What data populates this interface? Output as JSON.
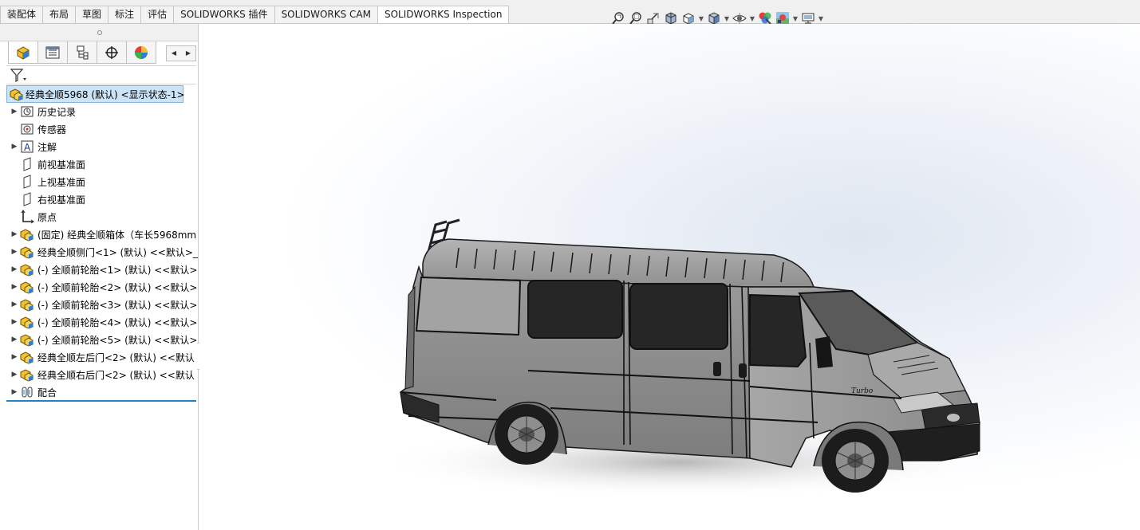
{
  "command_tabs": [
    "装配体",
    "布局",
    "草图",
    "标注",
    "评估",
    "SOLIDWORKS 插件",
    "SOLIDWORKS CAM",
    "SOLIDWORKS Inspection"
  ],
  "active_tab_index": 7,
  "heads_up_toolbar": [
    "zoom-to-fit-icon",
    "zoom-area-icon",
    "previous-view-icon",
    "section-view-icon",
    "view-orientation-icon",
    "display-style-icon",
    "hide-show-items-icon",
    "edit-appearance-icon",
    "apply-scene-icon",
    "view-settings-icon"
  ],
  "panel_tabs": [
    "feature-manager-icon",
    "property-manager-icon",
    "configuration-manager-icon",
    "dimxpert-manager-icon",
    "display-manager-icon"
  ],
  "tree": {
    "root_label": "经典全顺5968 (默认) <显示状态-1>",
    "items": [
      {
        "label": "历史记录",
        "icon": "history-icon",
        "expandable": true
      },
      {
        "label": "传感器",
        "icon": "sensor-icon",
        "expandable": false
      },
      {
        "label": "注解",
        "icon": "annotation-icon",
        "expandable": true
      },
      {
        "label": "前视基准面",
        "icon": "plane-icon",
        "expandable": false
      },
      {
        "label": "上视基准面",
        "icon": "plane-icon",
        "expandable": false
      },
      {
        "label": "右视基准面",
        "icon": "plane-icon",
        "expandable": false
      },
      {
        "label": "原点",
        "icon": "origin-icon",
        "expandable": false
      },
      {
        "label": "(固定) 经典全顺箱体（车长5968mm",
        "icon": "subassembly-icon",
        "expandable": true
      },
      {
        "label": "经典全顺侧门<1> (默认) <<默认>_",
        "icon": "subassembly-icon",
        "expandable": true
      },
      {
        "label": "(-) 全顺前轮胎<1> (默认) <<默认>",
        "icon": "subassembly-icon",
        "expandable": true
      },
      {
        "label": "(-) 全顺前轮胎<2> (默认) <<默认>",
        "icon": "subassembly-icon",
        "expandable": true
      },
      {
        "label": "(-) 全顺前轮胎<3> (默认) <<默认>",
        "icon": "subassembly-icon",
        "expandable": true
      },
      {
        "label": "(-) 全顺前轮胎<4> (默认) <<默认>",
        "icon": "subassembly-icon",
        "expandable": true
      },
      {
        "label": "(-) 全顺前轮胎<5> (默认) <<默认>",
        "icon": "subassembly-icon",
        "expandable": true
      },
      {
        "label": "经典全顺左后门<2> (默认) <<默认",
        "icon": "subassembly-icon",
        "expandable": true
      },
      {
        "label": "经典全顺右后门<2> (默认) <<默认",
        "icon": "subassembly-icon",
        "expandable": true
      },
      {
        "label": "配合",
        "icon": "mates-icon",
        "expandable": true
      }
    ]
  },
  "model": {
    "badge_text": "Turbo"
  },
  "colors": {
    "selection": "#cce4f7",
    "accent": "#1a82c8",
    "body": "#8c8c8c"
  }
}
